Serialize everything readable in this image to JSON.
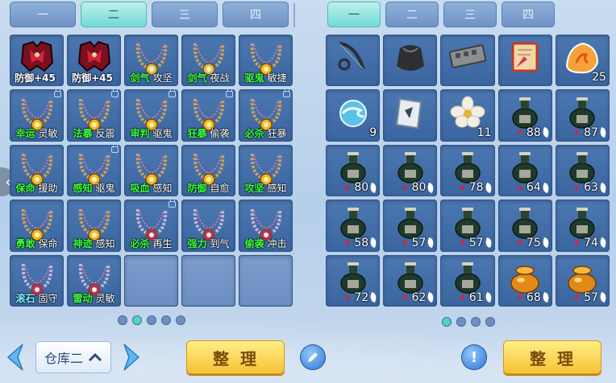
{
  "left_tabs": [
    {
      "label": "一"
    },
    {
      "label": "二",
      "active": true
    },
    {
      "label": "三"
    },
    {
      "label": "四"
    }
  ],
  "right_tabs": [
    {
      "label": "一",
      "active": true
    },
    {
      "label": "二"
    },
    {
      "label": "三"
    },
    {
      "label": "四"
    }
  ],
  "colors": {
    "green": "#3bff3b",
    "yellow": "#ffe03a",
    "red": "#ff4646",
    "white": "#ffffff",
    "cyan": "#7ff0ff"
  },
  "left_items": [
    {
      "icon": "armor-icon",
      "a": "防御+45",
      "b": "",
      "ac": "white",
      "locked": false
    },
    {
      "icon": "armor-icon",
      "a": "防御+45",
      "b": "",
      "ac": "white",
      "locked": false
    },
    {
      "icon": "necklace-icon",
      "a": "剑气",
      "b": "攻坚",
      "ac": "green",
      "locked": false
    },
    {
      "icon": "necklace-icon",
      "a": "剑气",
      "b": "夜战",
      "ac": "green",
      "locked": false
    },
    {
      "icon": "necklace-gold-icon",
      "a": "驱鬼",
      "b": "敏捷",
      "ac": "green",
      "locked": false
    },
    {
      "icon": "necklace-gold-icon",
      "a": "幸运",
      "b": "灵敏",
      "ac": "green",
      "locked": true
    },
    {
      "icon": "necklace-gold-icon",
      "a": "法暴",
      "b": "反震",
      "ac": "green",
      "locked": true
    },
    {
      "icon": "necklace-gold-icon",
      "a": "审判",
      "b": "驱鬼",
      "ac": "green",
      "locked": true
    },
    {
      "icon": "necklace-gold-icon",
      "a": "狂暴",
      "b": "偷袭",
      "ac": "green",
      "locked": true
    },
    {
      "icon": "necklace-gold-icon",
      "a": "必杀",
      "b": "狂暴",
      "ac": "green",
      "locked": true
    },
    {
      "icon": "necklace-gold-icon",
      "a": "保命",
      "b": "援助",
      "ac": "green",
      "locked": false
    },
    {
      "icon": "necklace-gold-icon",
      "a": "感知",
      "b": "驱鬼",
      "ac": "green",
      "locked": true
    },
    {
      "icon": "necklace-gold-icon",
      "a": "吸血",
      "b": "感知",
      "ac": "green",
      "locked": false
    },
    {
      "icon": "necklace-gold-icon",
      "a": "防御",
      "b": "自愈",
      "ac": "green",
      "locked": false
    },
    {
      "icon": "necklace-gold-icon",
      "a": "攻坚",
      "b": "感知",
      "ac": "green",
      "locked": false
    },
    {
      "icon": "necklace-gold-icon",
      "a": "勇敢",
      "b": "保命",
      "ac": "green",
      "locked": false
    },
    {
      "icon": "necklace-gold-icon",
      "a": "神迹",
      "b": "感知",
      "ac": "green",
      "locked": false
    },
    {
      "icon": "necklace-pink-icon",
      "a": "必杀",
      "b": "再生",
      "ac": "green",
      "locked": true
    },
    {
      "icon": "necklace-pink-icon",
      "a": "强力",
      "b": "到气",
      "ac": "green",
      "locked": false
    },
    {
      "icon": "necklace-pink-icon",
      "a": "偷袭",
      "b": "冲击",
      "ac": "green",
      "locked": false
    },
    {
      "icon": "necklace-pink-icon",
      "a": "滚石",
      "b": "固守",
      "ac": "cyan",
      "locked": false
    },
    {
      "icon": "necklace-pink-icon",
      "a": "雷动",
      "b": "灵敏",
      "ac": "green",
      "locked": false
    },
    {
      "icon": "",
      "a": "",
      "b": "",
      "ac": "green",
      "locked": false
    },
    {
      "icon": "",
      "a": "",
      "b": "",
      "ac": "green",
      "locked": false
    },
    {
      "icon": "",
      "a": "",
      "b": "",
      "ac": "green",
      "locked": false
    }
  ],
  "right_items": [
    {
      "icon": "bow-icon",
      "count": "",
      "leaf": false
    },
    {
      "icon": "pouch-icon",
      "count": "",
      "leaf": false
    },
    {
      "icon": "iron-plate-icon",
      "count": "",
      "leaf": false
    },
    {
      "icon": "scroll-icon",
      "count": "",
      "leaf": false
    },
    {
      "icon": "flame-rune-icon",
      "count": "25",
      "leaf": false
    },
    {
      "icon": "orb-icon",
      "count": "9",
      "leaf": false
    },
    {
      "icon": "talisman-icon",
      "count": "",
      "leaf": false
    },
    {
      "icon": "flower-icon",
      "count": "11",
      "leaf": false
    },
    {
      "icon": "green-jar-icon",
      "count": "88",
      "leaf": true
    },
    {
      "icon": "green-jar-icon",
      "count": "87",
      "leaf": true
    },
    {
      "icon": "green-jar-icon",
      "count": "80",
      "leaf": true
    },
    {
      "icon": "green-jar-icon",
      "count": "80",
      "leaf": true
    },
    {
      "icon": "green-jar-icon",
      "count": "78",
      "leaf": true
    },
    {
      "icon": "green-jar-icon",
      "count": "64",
      "leaf": true
    },
    {
      "icon": "green-jar-icon",
      "count": "63",
      "leaf": true
    },
    {
      "icon": "green-jar-icon",
      "count": "58",
      "leaf": true
    },
    {
      "icon": "green-jar-icon",
      "count": "57",
      "leaf": true
    },
    {
      "icon": "green-jar-icon",
      "count": "57",
      "leaf": true
    },
    {
      "icon": "green-jar-icon",
      "count": "75",
      "leaf": true
    },
    {
      "icon": "green-jar-icon",
      "count": "74",
      "leaf": true
    },
    {
      "icon": "green-jar-icon",
      "count": "72",
      "leaf": true
    },
    {
      "icon": "green-jar-icon",
      "count": "62",
      "leaf": true
    },
    {
      "icon": "green-jar-icon",
      "count": "61",
      "leaf": true
    },
    {
      "icon": "gold-jar-icon",
      "count": "68",
      "leaf": true
    },
    {
      "icon": "gold-jar-icon",
      "count": "57",
      "leaf": true
    }
  ],
  "left_pager": {
    "count": 5,
    "active": 1
  },
  "right_pager": {
    "count": 4,
    "active": 0
  },
  "warehouse": {
    "label": "仓库二"
  },
  "sort_left": "整理",
  "sort_right": "整理",
  "info_button": "!"
}
